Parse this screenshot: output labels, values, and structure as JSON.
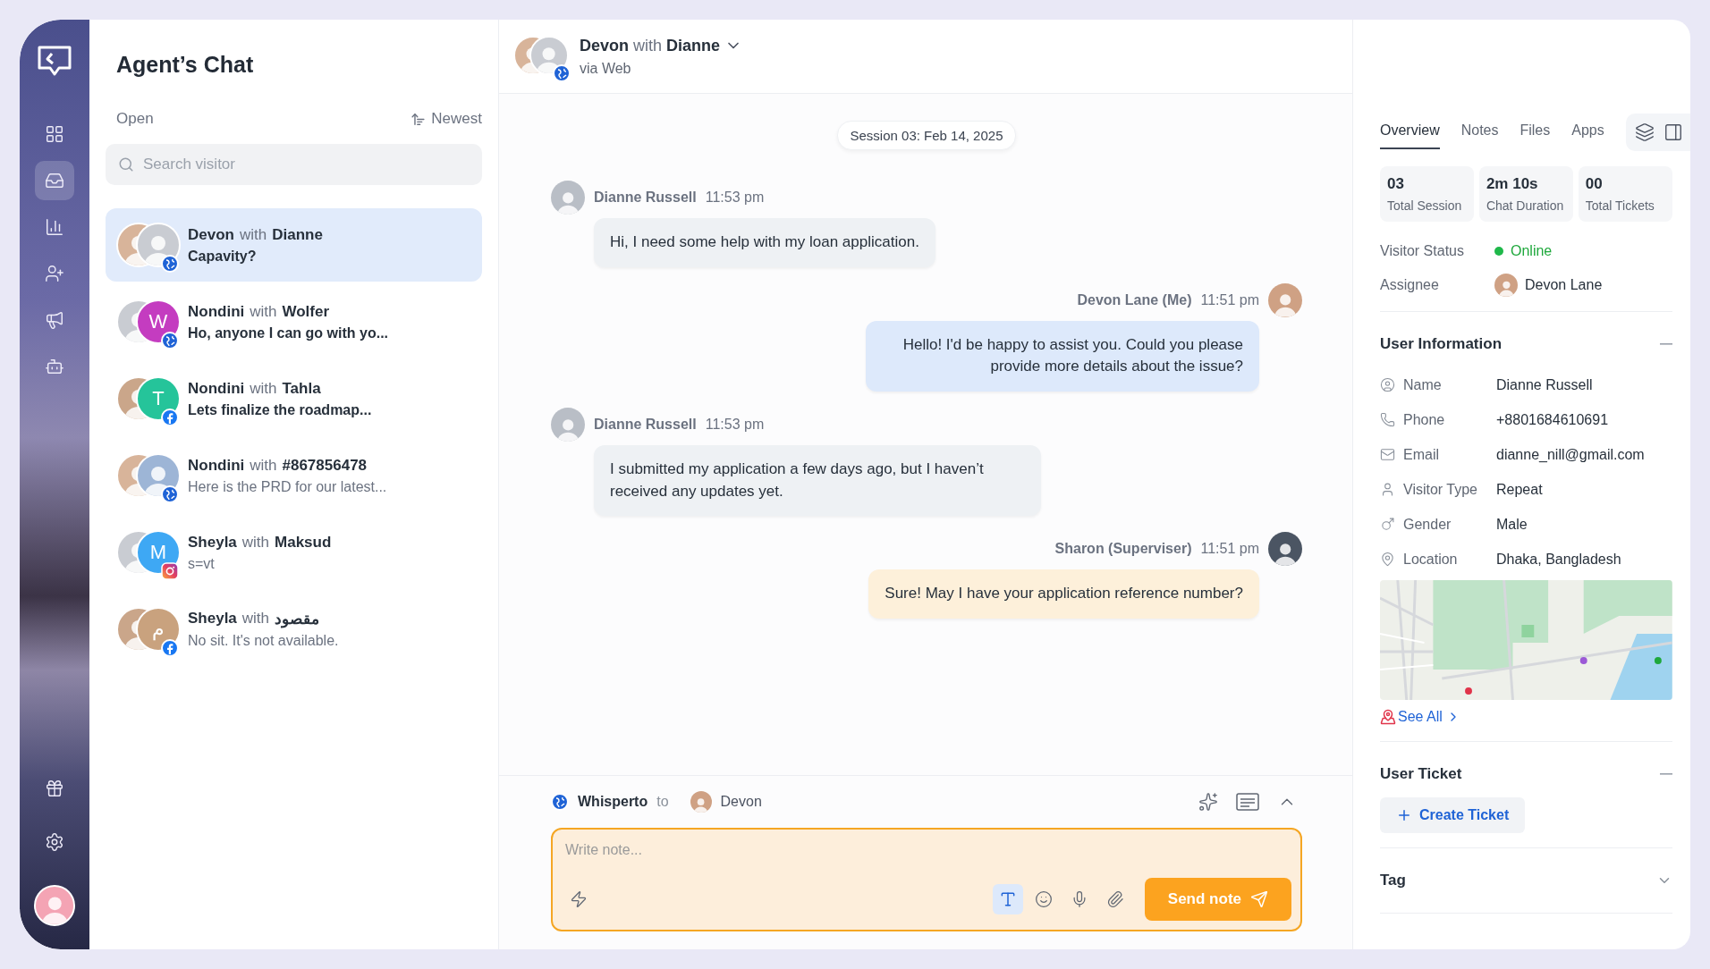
{
  "nav": {
    "top": [
      {
        "kind": "grid",
        "selected": false
      },
      {
        "kind": "inbox",
        "selected": true
      },
      {
        "kind": "chart",
        "selected": false
      },
      {
        "kind": "contact",
        "selected": false
      },
      {
        "kind": "megaphone",
        "selected": false
      },
      {
        "kind": "bot",
        "selected": false
      }
    ],
    "bottom": [
      {
        "kind": "gift",
        "selected": false
      },
      {
        "kind": "settings",
        "selected": false
      }
    ]
  },
  "chat_list": {
    "title": "Agent’s Chat",
    "filter": "Open",
    "sort": "Newest",
    "search": {
      "placeholder": "Search visitor"
    },
    "conversations": [
      {
        "agent": "Devon",
        "with": "with",
        "visitor": "Dianne",
        "preview": "Capavity?",
        "unread": true,
        "selected": true,
        "badge": {
          "kind": "web"
        },
        "visitor_avatar": {
          "kind": "photo"
        }
      },
      {
        "agent": "Nondini",
        "with": "with",
        "visitor": "Wolfer",
        "preview": "Ho, anyone I can go with yo...",
        "unread": true,
        "selected": false,
        "badge": {
          "kind": "web"
        },
        "visitor_avatar": {
          "kind": "letter",
          "initial": "W",
          "color": "#c43cc0"
        }
      },
      {
        "agent": "Nondini",
        "with": "with",
        "visitor": "Tahla",
        "preview": "Lets finalize the roadmap...",
        "unread": true,
        "selected": false,
        "badge": {
          "kind": "facebook"
        },
        "visitor_avatar": {
          "kind": "letter",
          "initial": "T",
          "color": "#25c49a"
        }
      },
      {
        "agent": "Nondini",
        "with": "with",
        "visitor": "#867856478",
        "preview": "Here is the PRD for our latest...",
        "unread": false,
        "selected": false,
        "badge": {
          "kind": "web"
        },
        "visitor_avatar": {
          "kind": "silhouette"
        }
      },
      {
        "agent": "Sheyla",
        "with": "with",
        "visitor": "Maksud",
        "preview": "s=vt",
        "unread": false,
        "selected": false,
        "badge": {
          "kind": "instagram"
        },
        "visitor_avatar": {
          "kind": "letter",
          "initial": "M",
          "color": "#3ea8f4"
        }
      },
      {
        "agent": "Sheyla",
        "with": "with",
        "visitor": "مقصود",
        "preview": "No sit. It's not available.",
        "unread": false,
        "selected": false,
        "badge": {
          "kind": "facebook"
        },
        "visitor_avatar": {
          "kind": "letter",
          "initial": "م",
          "color": "#c9a27e"
        }
      }
    ]
  },
  "conversation": {
    "agent": "Devon",
    "with": "with",
    "visitor": "Dianne",
    "badge": {
      "kind": "web"
    },
    "source": "via Web",
    "session": "Session 03: Feb 14, 2025",
    "messages": [
      {
        "kind": "visitor",
        "sender": "Dianne Russell",
        "time": "11:53 pm",
        "text": "Hi, I need some help with my loan application."
      },
      {
        "kind": "agent",
        "sender": "Devon Lane (Me)",
        "time": "11:51 pm",
        "text": "Hello! I'd be happy to assist you. Could you please provide more details about the issue?"
      },
      {
        "kind": "visitor",
        "sender": "Dianne Russell",
        "time": "11:53 pm",
        "text": "I submitted my application a few days ago, but I haven’t received any updates yet."
      },
      {
        "kind": "supervisor",
        "sender": "Sharon (Superviser)",
        "time": "11:51 pm",
        "text": "Sure! May I have your application reference number?"
      }
    ]
  },
  "composer": {
    "mode": "Whisperto",
    "to": "to",
    "recipient": "Devon",
    "placeholder": "Write note...",
    "format_selected": true,
    "send": "Send note"
  },
  "details": {
    "tabs": [
      {
        "label": "Overview",
        "selected": true
      },
      {
        "label": "Notes",
        "selected": false
      },
      {
        "label": "Files",
        "selected": false
      },
      {
        "label": "Apps",
        "selected": false
      }
    ],
    "stats": [
      {
        "value": "03",
        "label": "Total Session"
      },
      {
        "value": "2m 10s",
        "label": "Chat Duration"
      },
      {
        "value": "00",
        "label": "Total Tickets"
      }
    ],
    "status": {
      "label": "Visitor Status",
      "value": "Online",
      "online": true
    },
    "assignee": {
      "label": "Assignee",
      "value": "Devon Lane"
    },
    "user_information": {
      "title": "User Information",
      "expanded": true,
      "fields": [
        {
          "kind": "name",
          "label": "Name",
          "value": "Dianne Russell"
        },
        {
          "kind": "phone",
          "label": "Phone",
          "value": "+8801684610691"
        },
        {
          "kind": "email",
          "label": "Email",
          "value": "dianne_nill@gmail.com"
        },
        {
          "kind": "visitor_type",
          "label": "Visitor Type",
          "value": "Repeat"
        },
        {
          "kind": "gender",
          "label": "Gender",
          "value": "Male"
        },
        {
          "kind": "location",
          "label": "Location",
          "value": "Dhaka, Bangladesh"
        }
      ],
      "see_all": "See All"
    },
    "user_ticket": {
      "title": "User Ticket",
      "expanded": true,
      "action": "Create Ticket"
    },
    "tag": {
      "title": "Tag",
      "expanded": false
    }
  }
}
